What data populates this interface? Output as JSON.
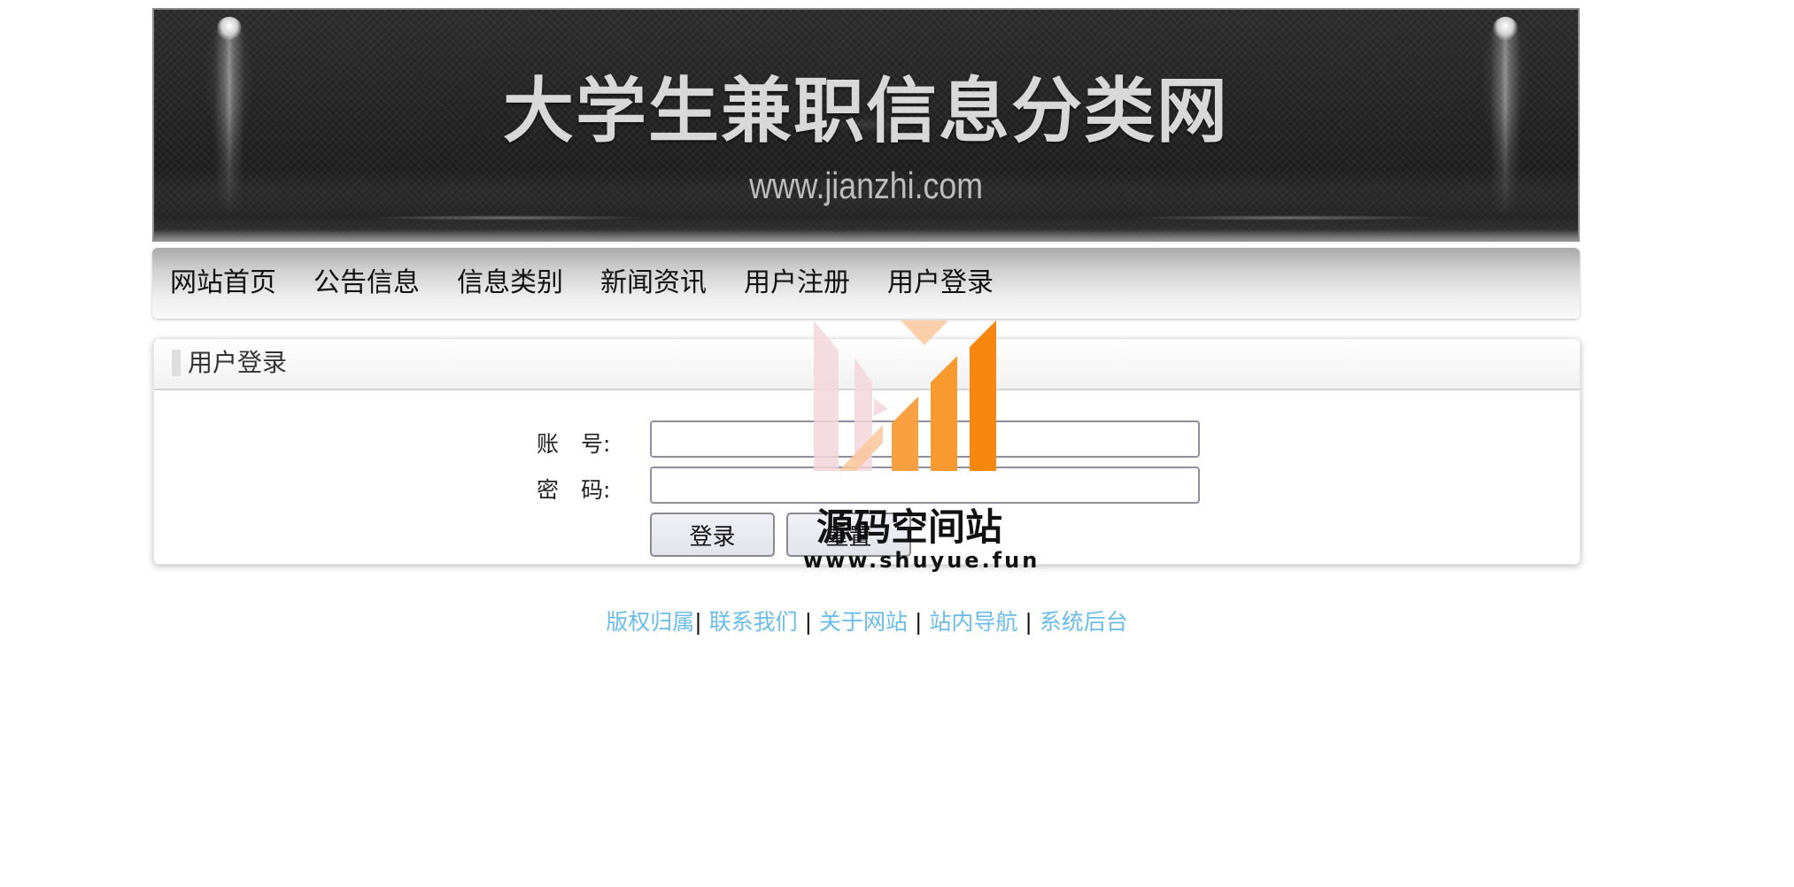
{
  "banner": {
    "title": "大学生兼职信息分类网",
    "url": "www.jianzhi.com"
  },
  "nav": {
    "items": [
      {
        "label": "网站首页"
      },
      {
        "label": "公告信息"
      },
      {
        "label": "信息类别"
      },
      {
        "label": "新闻资讯"
      },
      {
        "label": "用户注册"
      },
      {
        "label": "用户登录"
      }
    ]
  },
  "login": {
    "panel_title": "用户登录",
    "account_label": "账　号:",
    "password_label": "密　码:",
    "account_value": "",
    "password_value": "",
    "login_button": "登录",
    "reset_button": "重置"
  },
  "footer": {
    "links": [
      "版权归属",
      "联系我们",
      "关于网站",
      "站内导航",
      "系统后台"
    ],
    "separator": "|"
  },
  "watermark": {
    "name": "源码空间站",
    "url": "www.shuyue.fun"
  },
  "colors": {
    "footer_link": "#6bbce8",
    "banner_bg": "#262626",
    "watermark_orange": "#f7931e",
    "watermark_pink": "#f3d6db"
  }
}
